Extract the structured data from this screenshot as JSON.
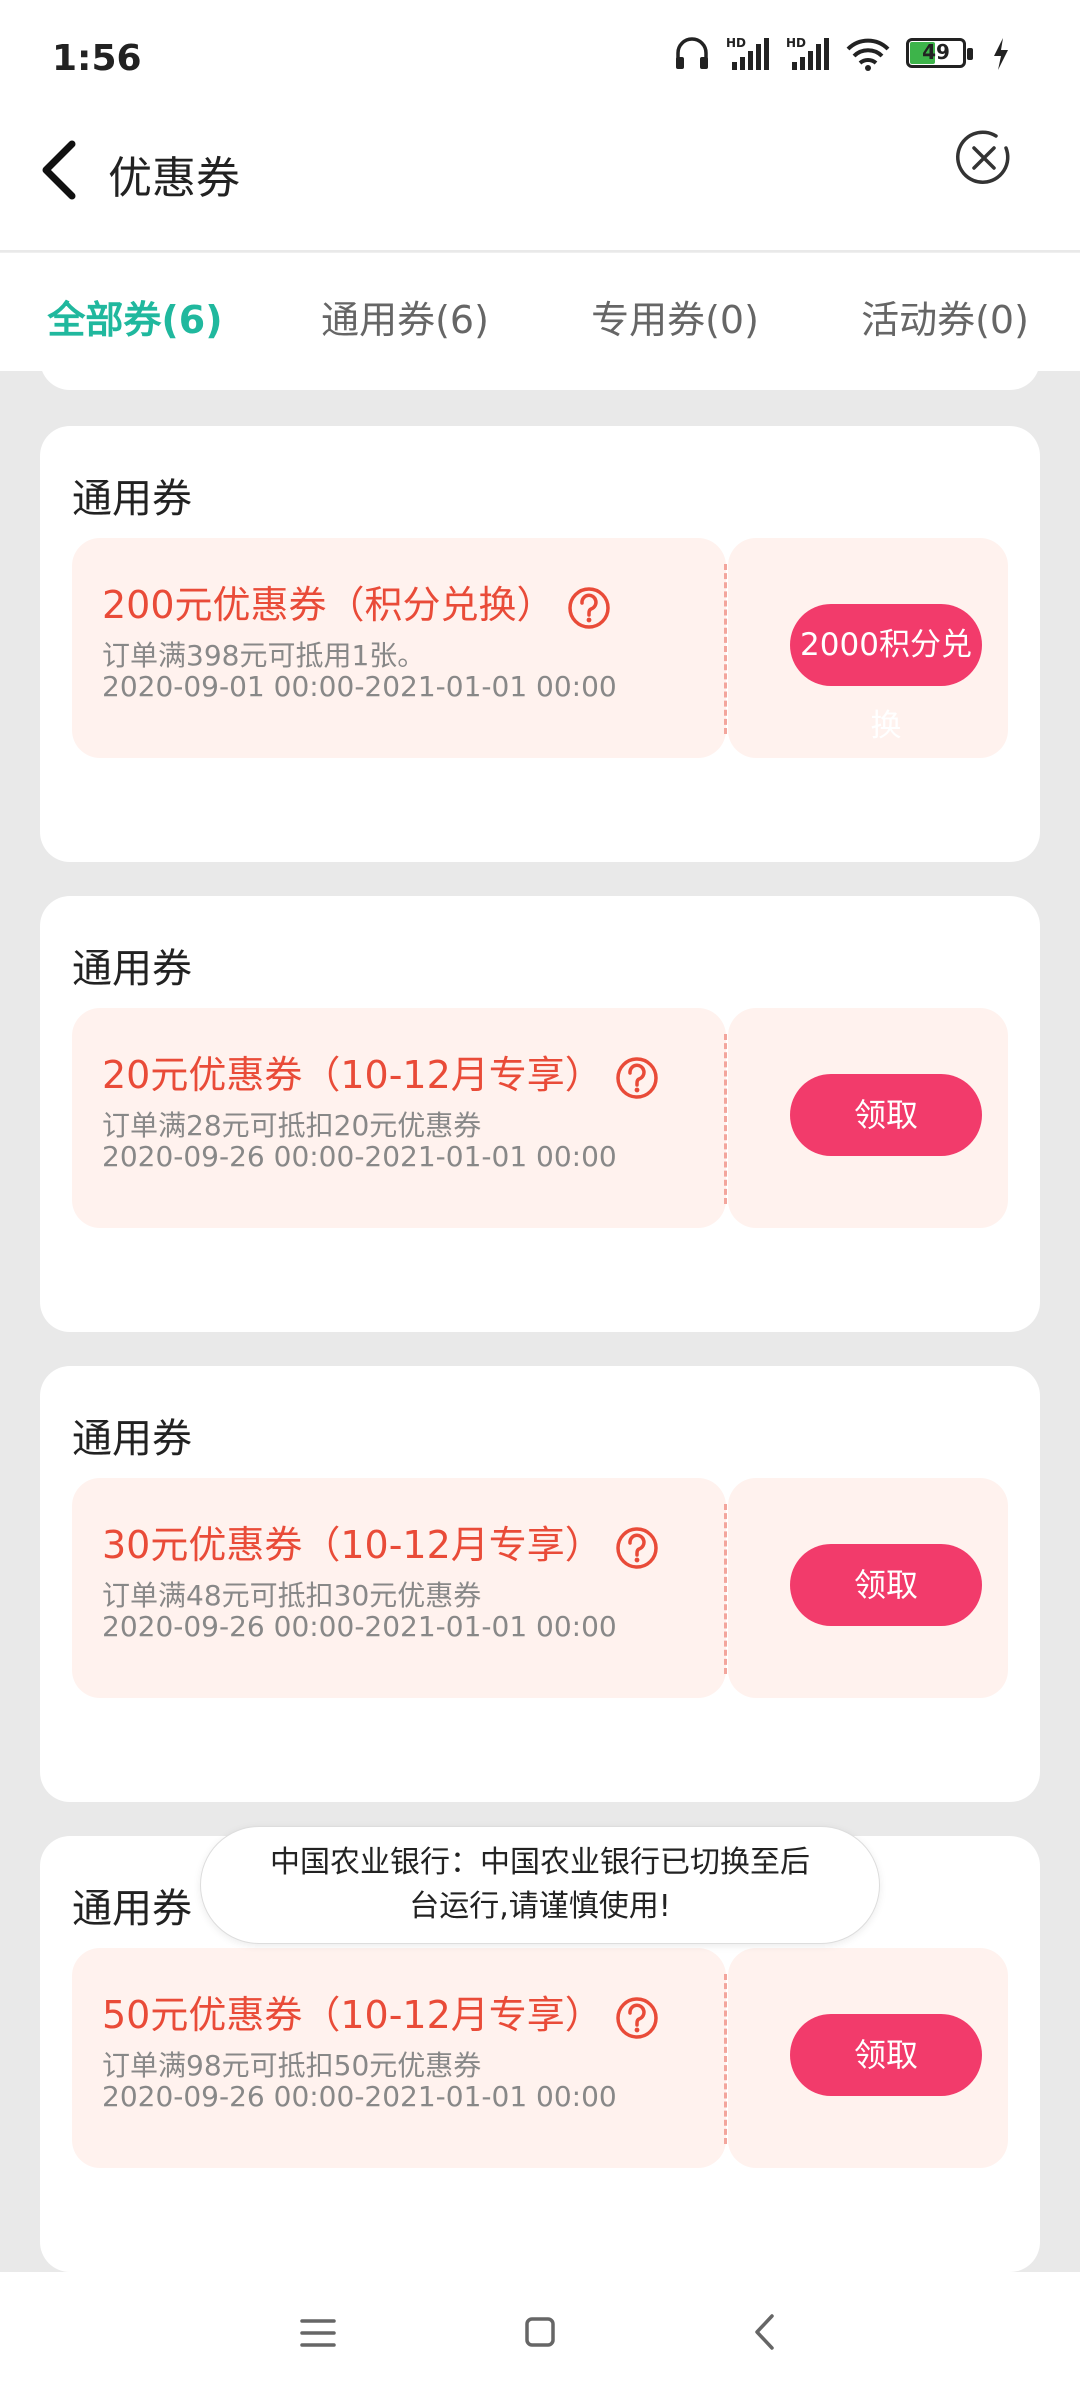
{
  "status_bar": {
    "time": "1:56",
    "battery": "49",
    "battery_level": 0.49
  },
  "header": {
    "title": "优惠券"
  },
  "tabs": [
    {
      "label": "全部券(6)",
      "active": true
    },
    {
      "label": "通用券(6)",
      "active": false
    },
    {
      "label": "专用券(0)",
      "active": false
    },
    {
      "label": "活动券(0)",
      "active": false
    }
  ],
  "coupons": [
    {
      "category": "通用券",
      "name": "200元优惠券（积分兑换）",
      "desc": "订单满398元可抵用1张。",
      "date": "2020-09-01 00:00-2021-01-01 00:00",
      "button_line1": "2000积分兑",
      "button_line2": "换"
    },
    {
      "category": "通用券",
      "name": "20元优惠券（10-12月专享）",
      "desc": "订单满28元可抵扣20元优惠券",
      "date": "2020-09-26 00:00-2021-01-01 00:00",
      "button": "领取"
    },
    {
      "category": "通用券",
      "name": "30元优惠券（10-12月专享）",
      "desc": "订单满48元可抵扣30元优惠券",
      "date": "2020-09-26 00:00-2021-01-01 00:00",
      "button": "领取"
    },
    {
      "category": "通用券",
      "name": "50元优惠券（10-12月专享）",
      "desc": "订单满98元可抵扣50元优惠券",
      "date": "2020-09-26 00:00-2021-01-01 00:00",
      "button": "领取"
    }
  ],
  "toast": {
    "line1": "中国农业银行：中国农业银行已切换至后",
    "line2": "台运行,请谨慎使用!"
  },
  "colors": {
    "accent": "#20b89e",
    "coupon_text": "#e94b38",
    "button": "#f23b6b",
    "coupon_bg": "#fff2ee"
  }
}
